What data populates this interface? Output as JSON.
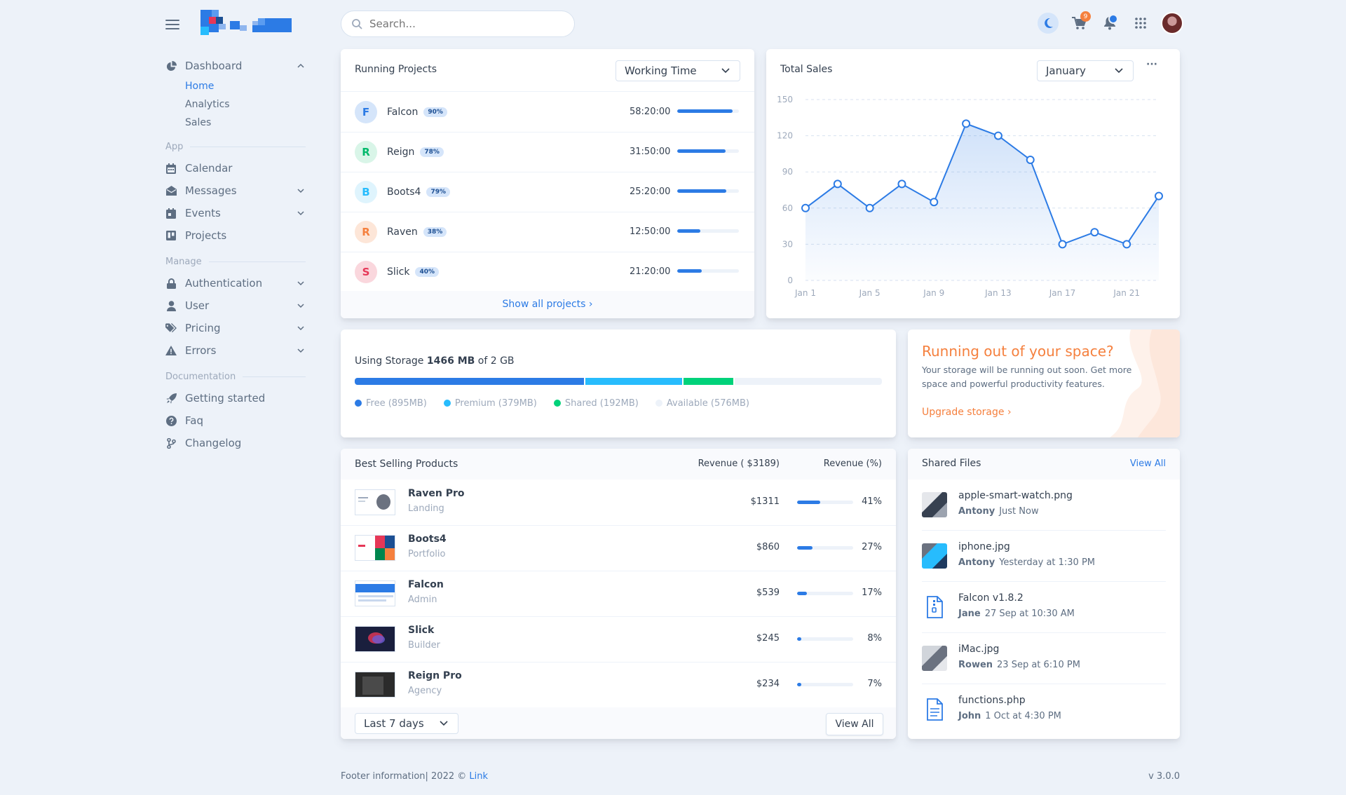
{
  "search": {
    "placeholder": "Search..."
  },
  "topbar": {
    "cart_count": "9",
    "icons": [
      "moon-icon",
      "cart-icon",
      "bell-icon",
      "grid-icon",
      "avatar"
    ]
  },
  "sidebar": {
    "dashboard": {
      "label": "Dashboard",
      "children": [
        "Home",
        "Analytics",
        "Sales"
      ]
    },
    "app_label": "App",
    "app_items": [
      "Calendar",
      "Messages",
      "Events",
      "Projects"
    ],
    "manage_label": "Manage",
    "manage_items": [
      "Authentication",
      "User",
      "Pricing",
      "Errors"
    ],
    "docs_label": "Documentation",
    "docs_items": [
      "Getting started",
      "Faq",
      "Changelog"
    ]
  },
  "running_projects": {
    "title": "Running Projects",
    "select": "Working Time",
    "projects": [
      {
        "initial": "F",
        "name": "Falcon",
        "pct": "90%",
        "time": "58:20:00",
        "progress": 0.9,
        "color": "#2c7be5",
        "bg": "#d5e5fa"
      },
      {
        "initial": "R",
        "name": "Reign",
        "pct": "78%",
        "time": "31:50:00",
        "progress": 0.78,
        "color": "#00b96b",
        "bg": "#d9f5e8"
      },
      {
        "initial": "B",
        "name": "Boots4",
        "pct": "79%",
        "time": "25:20:00",
        "progress": 0.79,
        "color": "#27bcfd",
        "bg": "#dff4fd"
      },
      {
        "initial": "R",
        "name": "Raven",
        "pct": "38%",
        "time": "12:50:00",
        "progress": 0.38,
        "color": "#f5803e",
        "bg": "#fde6d8"
      },
      {
        "initial": "S",
        "name": "Slick",
        "pct": "40%",
        "time": "21:20:00",
        "progress": 0.4,
        "color": "#e63757",
        "bg": "#fad7dd"
      }
    ],
    "show_all": "Show all projects"
  },
  "total_sales": {
    "title": "Total Sales",
    "select": "January",
    "more": "···"
  },
  "chart_data": {
    "type": "line",
    "title": "",
    "x": [
      "Jan 1",
      "Jan 2",
      "Jan 3",
      "Jan 4",
      "Jan 5",
      "Jan 6",
      "Jan 7",
      "Jan 8",
      "Jan 9",
      "Jan 10",
      "Jan 11",
      "Jan 12",
      "Jan 13",
      "Jan 14",
      "Jan 15",
      "Jan 16",
      "Jan 17",
      "Jan 18",
      "Jan 19",
      "Jan 20",
      "Jan 21",
      "Jan 22"
    ],
    "series": [
      {
        "values": [
          60,
          80,
          60,
          80,
          65,
          130,
          120,
          100,
          30,
          40,
          30,
          70
        ]
      }
    ],
    "point_days": [
      1,
      3,
      5,
      7,
      9,
      11,
      13,
      15,
      17,
      19,
      21,
      23
    ],
    "xticks": [
      "Jan 1",
      "Jan 5",
      "Jan 9",
      "Jan 13",
      "Jan 17",
      "Jan 21"
    ],
    "yticks": [
      0,
      30,
      60,
      90,
      120,
      150
    ],
    "ylim": [
      0,
      150
    ],
    "grid": true,
    "color": "#2c7be5"
  },
  "storage": {
    "prefix": "Using Storage ",
    "used": "1466 MB",
    "suffix": " of 2 GB",
    "segments": [
      {
        "label": "Free (895MB)",
        "color": "#2c7be5",
        "mb": 895
      },
      {
        "label": "Premium (379MB)",
        "color": "#27bcfd",
        "mb": 379
      },
      {
        "label": "Shared (192MB)",
        "color": "#00d27a",
        "mb": 192
      },
      {
        "label": "Available (576MB)",
        "color": "#edf2f9",
        "mb": 576
      }
    ]
  },
  "space_promo": {
    "title": "Running out of your space?",
    "body": "Your storage will be running out soon. Get more space and powerful productivity features.",
    "cta": "Upgrade storage"
  },
  "best_selling": {
    "title": "Best Selling Products",
    "col_revenue": "Revenue ( $3189)",
    "col_pct": "Revenue (%)",
    "products": [
      {
        "name": "Raven Pro",
        "category": "Landing",
        "revenue": "$1311",
        "pct": "41%",
        "share": 0.41
      },
      {
        "name": "Boots4",
        "category": "Portfolio",
        "revenue": "$860",
        "pct": "27%",
        "share": 0.27
      },
      {
        "name": "Falcon",
        "category": "Admin",
        "revenue": "$539",
        "pct": "17%",
        "share": 0.17
      },
      {
        "name": "Slick",
        "category": "Builder",
        "revenue": "$245",
        "pct": "8%",
        "share": 0.08
      },
      {
        "name": "Reign Pro",
        "category": "Agency",
        "revenue": "$234",
        "pct": "7%",
        "share": 0.07
      }
    ],
    "range_select": "Last 7 days",
    "view_all": "View All"
  },
  "shared_files": {
    "title": "Shared Files",
    "view_all": "View All",
    "files": [
      {
        "name": "apple-smart-watch.png",
        "who": "Antony",
        "when": "Just Now",
        "kind": "image"
      },
      {
        "name": "iphone.jpg",
        "who": "Antony",
        "when": "Yesterday at 1:30 PM",
        "kind": "image"
      },
      {
        "name": "Falcon v1.8.2",
        "who": "Jane",
        "when": "27 Sep at 10:30 AM",
        "kind": "zip"
      },
      {
        "name": "iMac.jpg",
        "who": "Rowen",
        "when": "23 Sep at 6:10 PM",
        "kind": "image"
      },
      {
        "name": "functions.php",
        "who": "John",
        "when": "1 Oct at 4:30 PM",
        "kind": "doc"
      }
    ]
  },
  "footer": {
    "text": "Footer information| 2022 © ",
    "link": "Link",
    "version": "v 3.0.0"
  }
}
